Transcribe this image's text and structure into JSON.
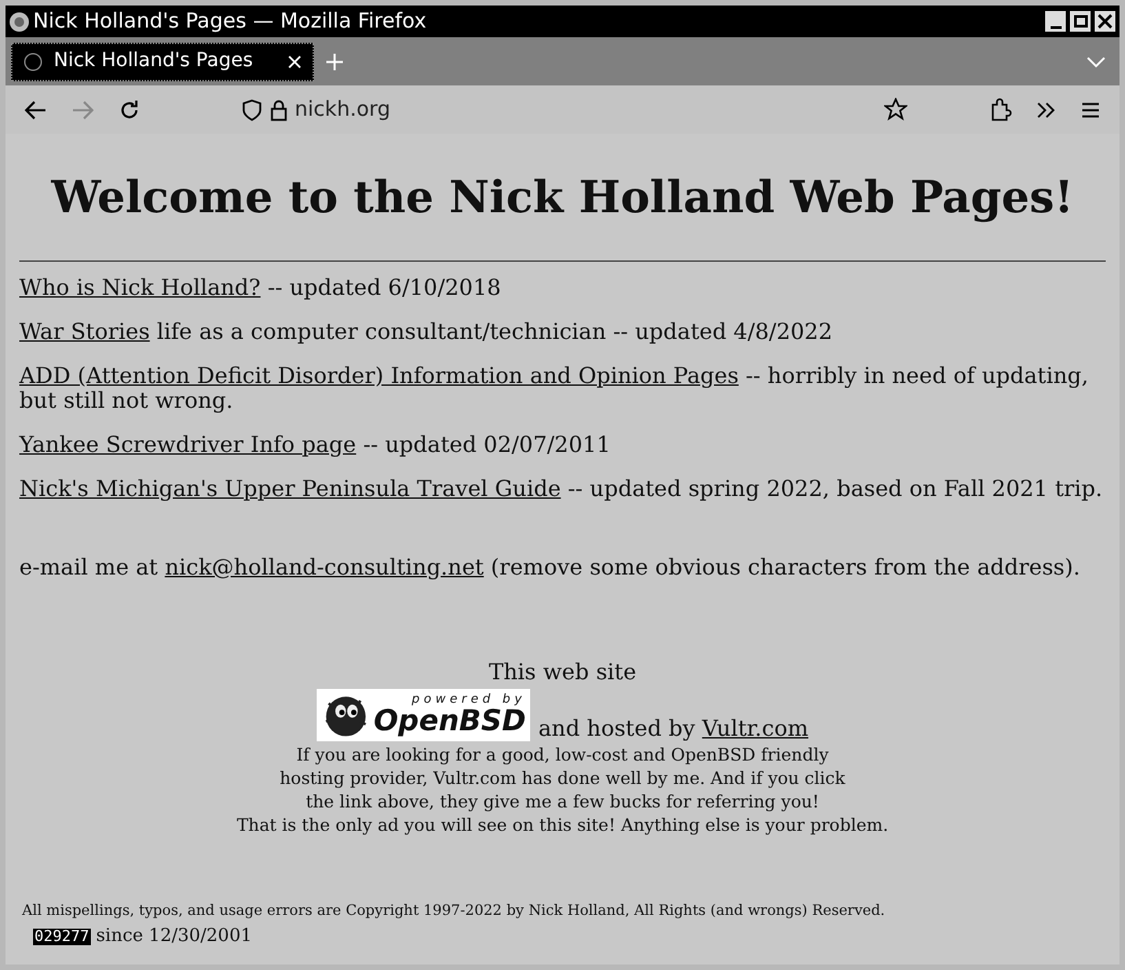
{
  "window": {
    "title": "Nick Holland's Pages — Mozilla Firefox"
  },
  "tabs": [
    {
      "label": "Nick Holland's Pages",
      "selected": true
    }
  ],
  "address_bar": {
    "url": "nickh.org"
  },
  "page": {
    "heading": "Welcome to the Nick Holland Web Pages!",
    "entries": [
      {
        "link": "Who is Nick Holland?",
        "text": " -- updated 6/10/2018"
      },
      {
        "link": "War Stories",
        "text": " life as a computer consultant/technician -- updated 4/8/2022"
      },
      {
        "link": "ADD (Attention Deficit Disorder) Information and Opinion Pages",
        "text": " -- horribly in need of updating, but still not wrong."
      },
      {
        "link": "Yankee Screwdriver Info page",
        "text": " -- updated 02/07/2011"
      },
      {
        "link": "Nick's Michigan's Upper Peninsula Travel Guide",
        "text": " -- updated spring 2022, based on Fall 2021 trip."
      }
    ],
    "email": {
      "before": "e-mail me at ",
      "link": "nick@holland-consulting.net",
      "after": " (remove some obvious characters from the address)."
    },
    "hosting": {
      "intro": "This web site",
      "badge_top": "powered by",
      "badge_name": "OpenBSD",
      "hosted_text": "and hosted by ",
      "hosted_link": "Vultr.com",
      "ad_lines": [
        "If you are looking for a good, low-cost and OpenBSD friendly",
        "hosting provider, Vultr.com has done well by me. And if you click",
        "the link above, they give me a few bucks for referring you!",
        "That is the only ad you will see on this site! Anything else is your problem."
      ]
    },
    "copyright": "All mispellings, typos, and usage errors are Copyright 1997-2022 by Nick Holland, All Rights (and wrongs) Reserved.",
    "counter": "029277",
    "counter_since": "since 12/30/2001"
  }
}
